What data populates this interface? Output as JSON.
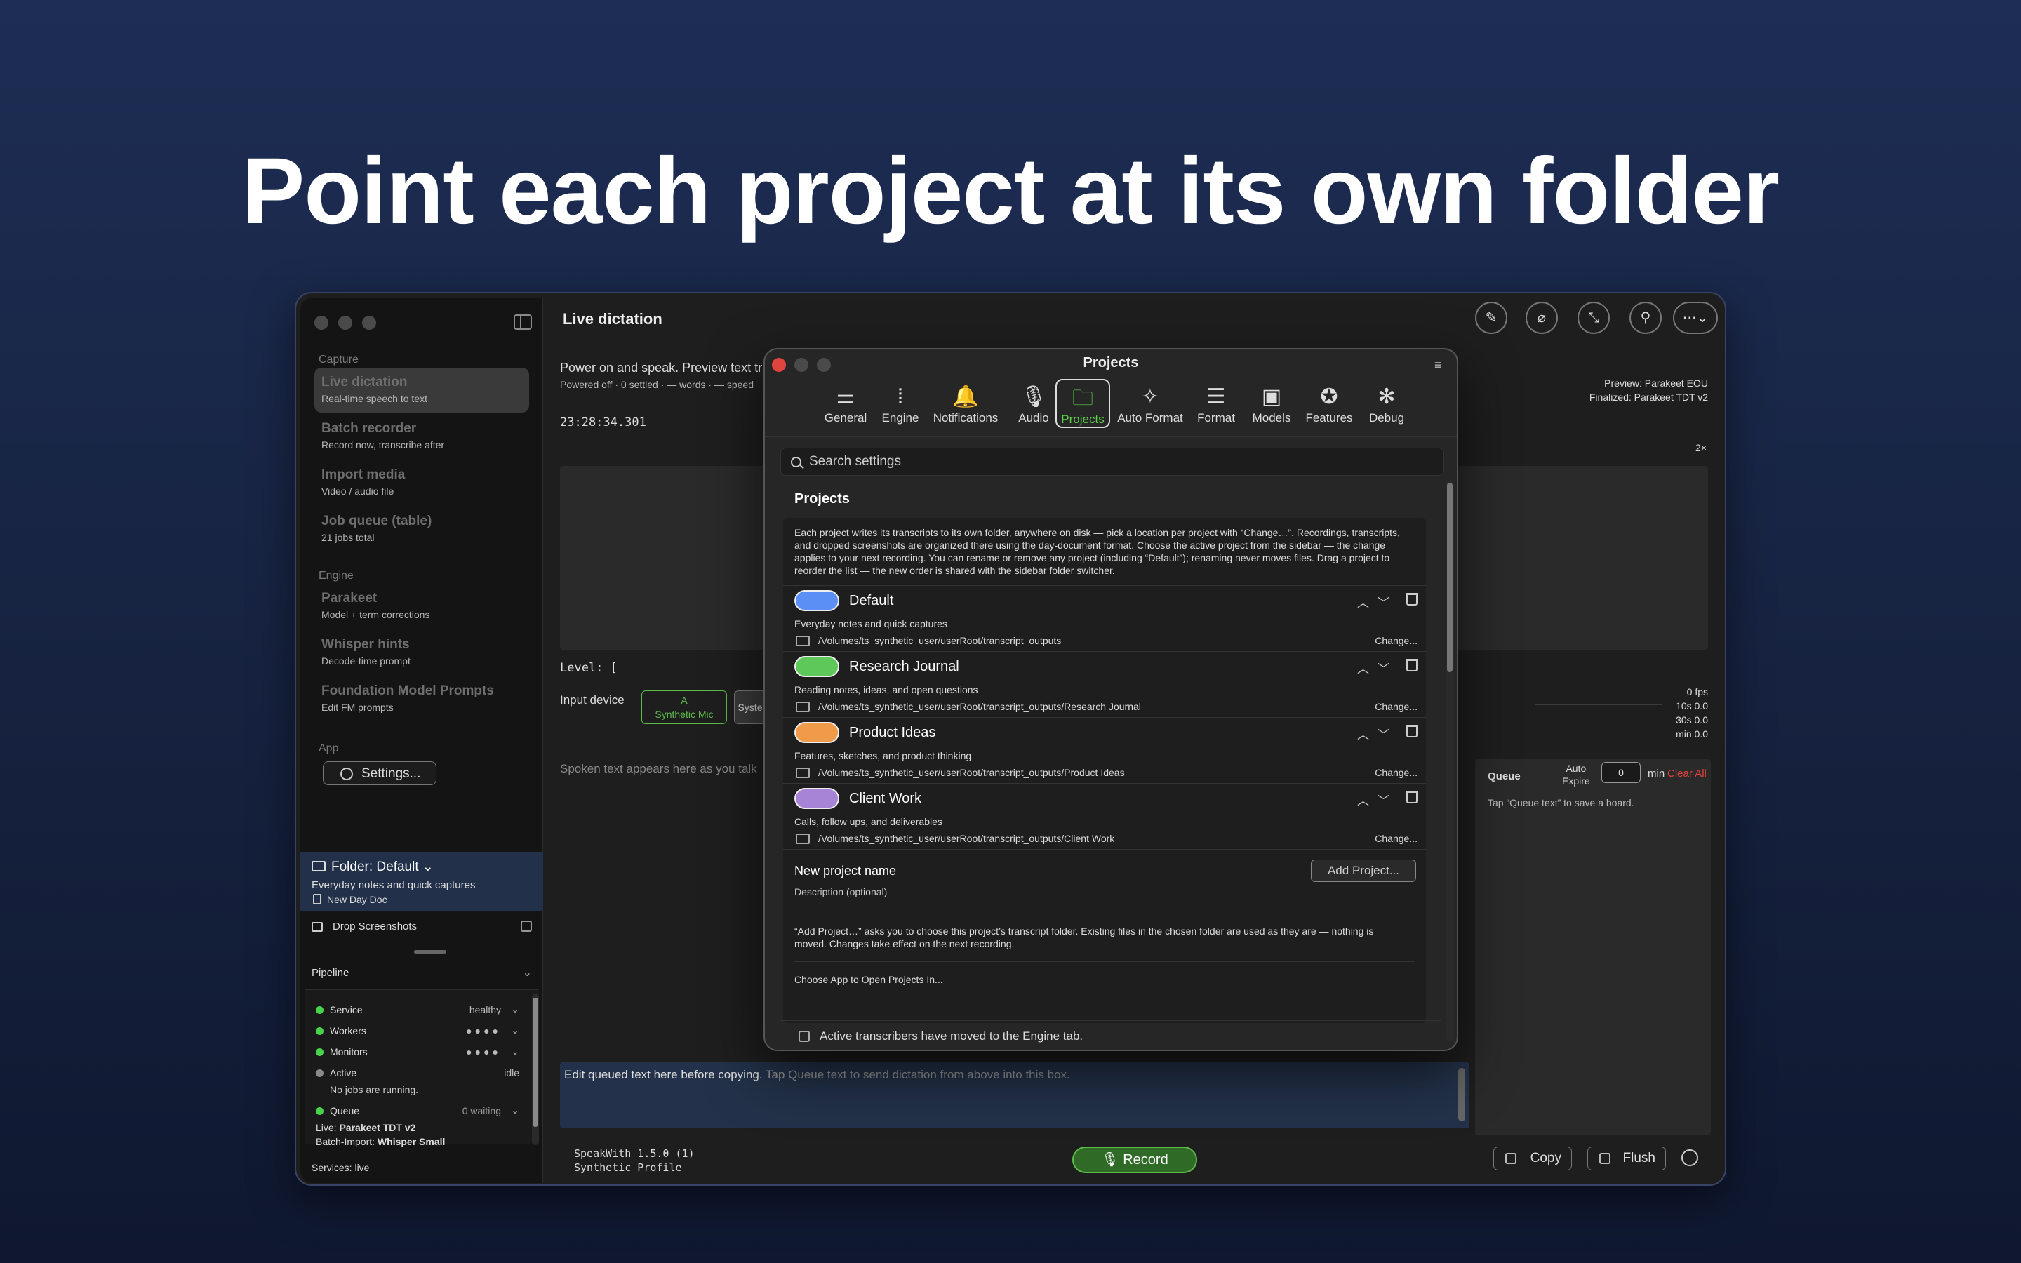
{
  "headline": "Point each project at its own folder",
  "window": {
    "title": "Live dictation",
    "sidebar": {
      "sections": {
        "capture": "Capture",
        "engine": "Engine",
        "app": "App"
      },
      "items": [
        {
          "title": "Live dictation",
          "subtitle": "Real-time speech to text",
          "selected": true
        },
        {
          "title": "Batch recorder",
          "subtitle": "Record now, transcribe after"
        },
        {
          "title": "Import media",
          "subtitle": "Video / audio file"
        },
        {
          "title": "Job queue (table)",
          "subtitle": "21 jobs total"
        },
        {
          "title": "Parakeet",
          "subtitle": "Model + term corrections"
        },
        {
          "title": "Whisper hints",
          "subtitle": "Decode-time prompt"
        },
        {
          "title": "Foundation Model Prompts",
          "subtitle": "Edit FM prompts"
        }
      ],
      "settings_label": "Settings...",
      "folder": {
        "title": "Folder: Default ⌄",
        "subtitle": "Everyday notes and quick captures",
        "new_day_doc": "New Day Doc"
      },
      "drop_screenshots": "Drop Screenshots",
      "pipeline": {
        "title": "Pipeline",
        "rows": [
          {
            "label": "Service",
            "value": "healthy",
            "status": "green"
          },
          {
            "label": "Workers",
            "value": "●●●●",
            "status": "green"
          },
          {
            "label": "Monitors",
            "value": "●●●●",
            "status": "green"
          },
          {
            "label": "Active",
            "value": "idle",
            "status": "gray"
          },
          {
            "label": "Queue",
            "value": "0 waiting",
            "status": "green"
          }
        ],
        "no_jobs": "No jobs are running.",
        "live_label": "Live:",
        "live_value": "Parakeet TDT v2",
        "batch_label": "Batch-Import:",
        "batch_value": "Whisper Small"
      },
      "services": "Services: live"
    },
    "main": {
      "power_text": "Power on and speak. Preview text tra",
      "power_sub": "Powered off · 0 settled · — words · — speed",
      "time": "23:28:34.301",
      "preview": "Preview: Parakeet EOU",
      "finalized": "Finalized: Parakeet TDT v2",
      "zoom": "2×",
      "level": "Level: [",
      "input_device": "Input device",
      "device_a_top": "A",
      "device_a_bottom": "Synthetic Mic",
      "device_b": "Syste",
      "fps": [
        "0 fps",
        "10s 0.0",
        "30s 0.0",
        "min 0.0"
      ],
      "spoken_placeholder": "Spoken text appears here as you talk",
      "queue": {
        "title": "Queue",
        "auto_expire": "Auto\nExpire",
        "expire_value": "0",
        "unit": "min",
        "clear_all": "Clear All",
        "hint": "Tap “Queue text” to save a board."
      },
      "editor_text": "Edit queued text here before copying.",
      "editor_hint": " Tap Queue text to send dictation from above into this box.",
      "version": "SpeakWith 1.5.0 (1)",
      "profile": "Synthetic Profile",
      "record": "Record",
      "copy": "Copy",
      "flush": "Flush"
    }
  },
  "dialog": {
    "title": "Projects",
    "tabs": [
      {
        "label": "General",
        "icon": "sliders-icon"
      },
      {
        "label": "Engine",
        "icon": "waveform-icon"
      },
      {
        "label": "Notifications",
        "icon": "bell-icon"
      },
      {
        "label": "Audio",
        "icon": "mic-icon"
      },
      {
        "label": "Projects",
        "icon": "folder-icon",
        "selected": true
      },
      {
        "label": "Auto Format",
        "icon": "wand-icon"
      },
      {
        "label": "Format",
        "icon": "text-align-icon"
      },
      {
        "label": "Models",
        "icon": "chip-icon"
      },
      {
        "label": "Features",
        "icon": "star-icon"
      },
      {
        "label": "Debug",
        "icon": "bug-icon"
      }
    ],
    "search_placeholder": "Search settings",
    "section_title": "Projects",
    "description": "Each project writes its transcripts to its own folder, anywhere on disk — pick a location per project with “Change…”. Recordings, transcripts, and dropped screenshots are organized there using the day-document format. Choose the active project from the sidebar — the change applies to your next recording. You can rename or remove any project (including “Default”); renaming never moves files. Drag a project to reorder the list — the new order is shared with the sidebar folder switcher.",
    "projects": [
      {
        "name": "Default",
        "description": "Everyday notes and quick captures",
        "path": "/Volumes/ts_synthetic_user/userRoot/transcript_outputs",
        "color": "#5b8ff5",
        "change": "Change..."
      },
      {
        "name": "Research Journal",
        "description": "Reading notes, ideas, and open questions",
        "path": "/Volumes/ts_synthetic_user/userRoot/transcript_outputs/Research Journal",
        "color": "#5ec95a",
        "change": "Change..."
      },
      {
        "name": "Product Ideas",
        "description": "Features, sketches, and product thinking",
        "path": "/Volumes/ts_synthetic_user/userRoot/transcript_outputs/Product Ideas",
        "color": "#ef9b4a",
        "change": "Change..."
      },
      {
        "name": "Client Work",
        "description": "Calls, follow ups, and deliverables",
        "path": "/Volumes/ts_synthetic_user/userRoot/transcript_outputs/Client Work",
        "color": "#a884d6",
        "change": "Change..."
      }
    ],
    "new_project_label": "New project name",
    "new_project_desc": "Description (optional)",
    "add_project": "Add Project...",
    "add_note": "“Add Project…” asks you to choose this project’s transcript folder. Existing files in the chosen folder are used as they are — nothing is moved. Changes take effect on the next recording.",
    "choose_app": "Choose App to Open Projects In...",
    "transcribers_note": "Active transcribers have moved to the Engine tab."
  }
}
